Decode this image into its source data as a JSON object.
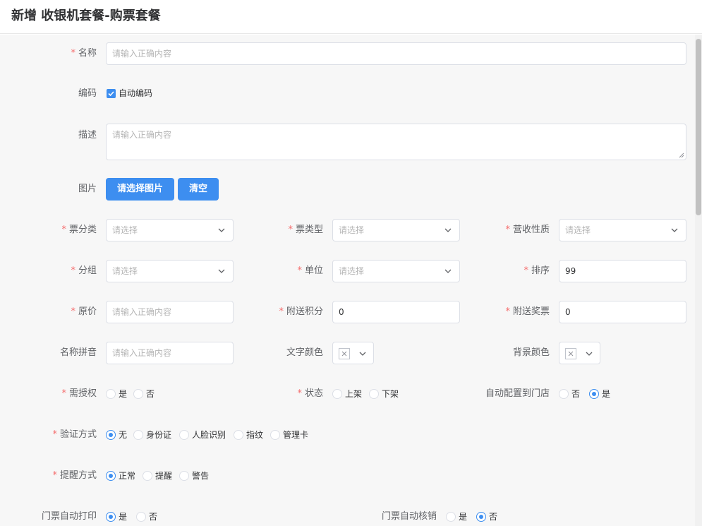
{
  "header": {
    "title": "新增 收银机套餐-购票套餐"
  },
  "form": {
    "name": {
      "label": "名称",
      "placeholder": "请输入正确内容"
    },
    "code": {
      "label": "编码",
      "auto_label": "自动编码"
    },
    "desc": {
      "label": "描述",
      "placeholder": "请输入正确内容"
    },
    "image": {
      "label": "图片",
      "select_btn": "请选择图片",
      "clear_btn": "清空"
    },
    "ticket_category": {
      "label": "票分类",
      "placeholder": "请选择"
    },
    "ticket_type": {
      "label": "票类型",
      "placeholder": "请选择"
    },
    "revenue_nature": {
      "label": "营收性质",
      "placeholder": "请选择"
    },
    "group": {
      "label": "分组",
      "placeholder": "请选择"
    },
    "unit": {
      "label": "单位",
      "placeholder": "请选择"
    },
    "sort": {
      "label": "排序",
      "value": "99"
    },
    "price": {
      "label": "原价",
      "placeholder": "请输入正确内容"
    },
    "bonus_points": {
      "label": "附送积分",
      "value": "0"
    },
    "bonus_tickets": {
      "label": "附送奖票",
      "value": "0"
    },
    "pinyin": {
      "label": "名称拼音",
      "placeholder": "请输入正确内容"
    },
    "text_color": {
      "label": "文字颜色"
    },
    "bg_color": {
      "label": "背景颜色"
    },
    "need_auth": {
      "label": "需授权",
      "options": [
        "是",
        "否"
      ]
    },
    "status": {
      "label": "状态",
      "options": [
        "上架",
        "下架"
      ]
    },
    "auto_store": {
      "label": "自动配置到门店",
      "options": [
        "否",
        "是"
      ]
    },
    "verify": {
      "label": "验证方式",
      "options": [
        "无",
        "身份证",
        "人脸识别",
        "指纹",
        "管理卡"
      ]
    },
    "remind": {
      "label": "提醒方式",
      "options": [
        "正常",
        "提醒",
        "警告"
      ]
    },
    "auto_print": {
      "label": "门票自动打印",
      "options": [
        "是",
        "否"
      ]
    },
    "auto_verify": {
      "label": "门票自动核销",
      "options": [
        "是",
        "否"
      ]
    }
  },
  "colors": {
    "primary": "#3d8ef0",
    "required": "#f56c6c",
    "border": "#dcdfe6"
  },
  "icons": [
    "chevron-down-icon",
    "check-icon",
    "clear-x-icon"
  ]
}
